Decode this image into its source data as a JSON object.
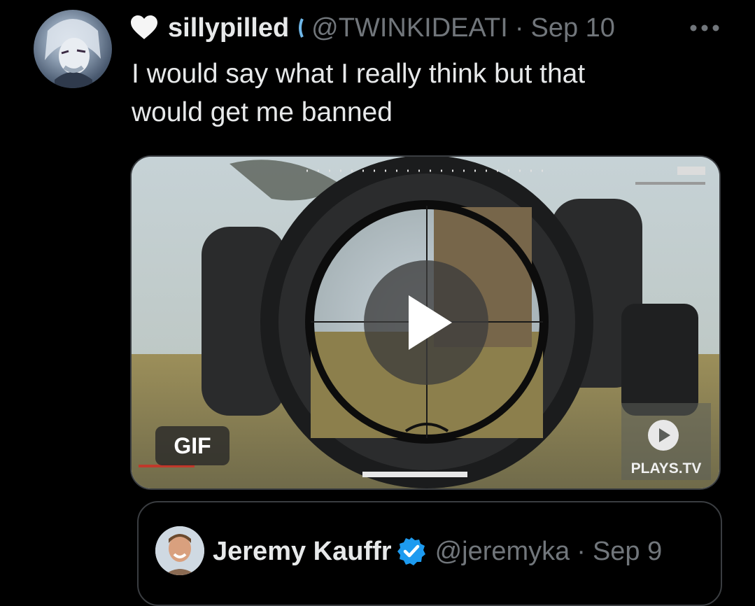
{
  "tweet": {
    "display_name": "sillypilled",
    "handle": "@TWINKIDEATI",
    "separator": "·",
    "date": "Sep 10",
    "text": "I would say what I really think but that would get me banned",
    "more_icon": "more-dots-icon",
    "name_icon": "heart-icon"
  },
  "media": {
    "badge": "GIF",
    "watermark": "PLAYS.TV",
    "play_icon": "play-icon"
  },
  "quoted_tweet": {
    "display_name": "Jeremy Kauffr",
    "handle": "@jeremyka",
    "separator": "·",
    "date": "Sep 9",
    "verified_icon": "verified-badge-icon"
  },
  "colors": {
    "background": "#000000",
    "primary_text": "#e7e9ea",
    "secondary_text": "#71767b",
    "verified_blue": "#1d9bf0",
    "border": "#3a3d41"
  }
}
